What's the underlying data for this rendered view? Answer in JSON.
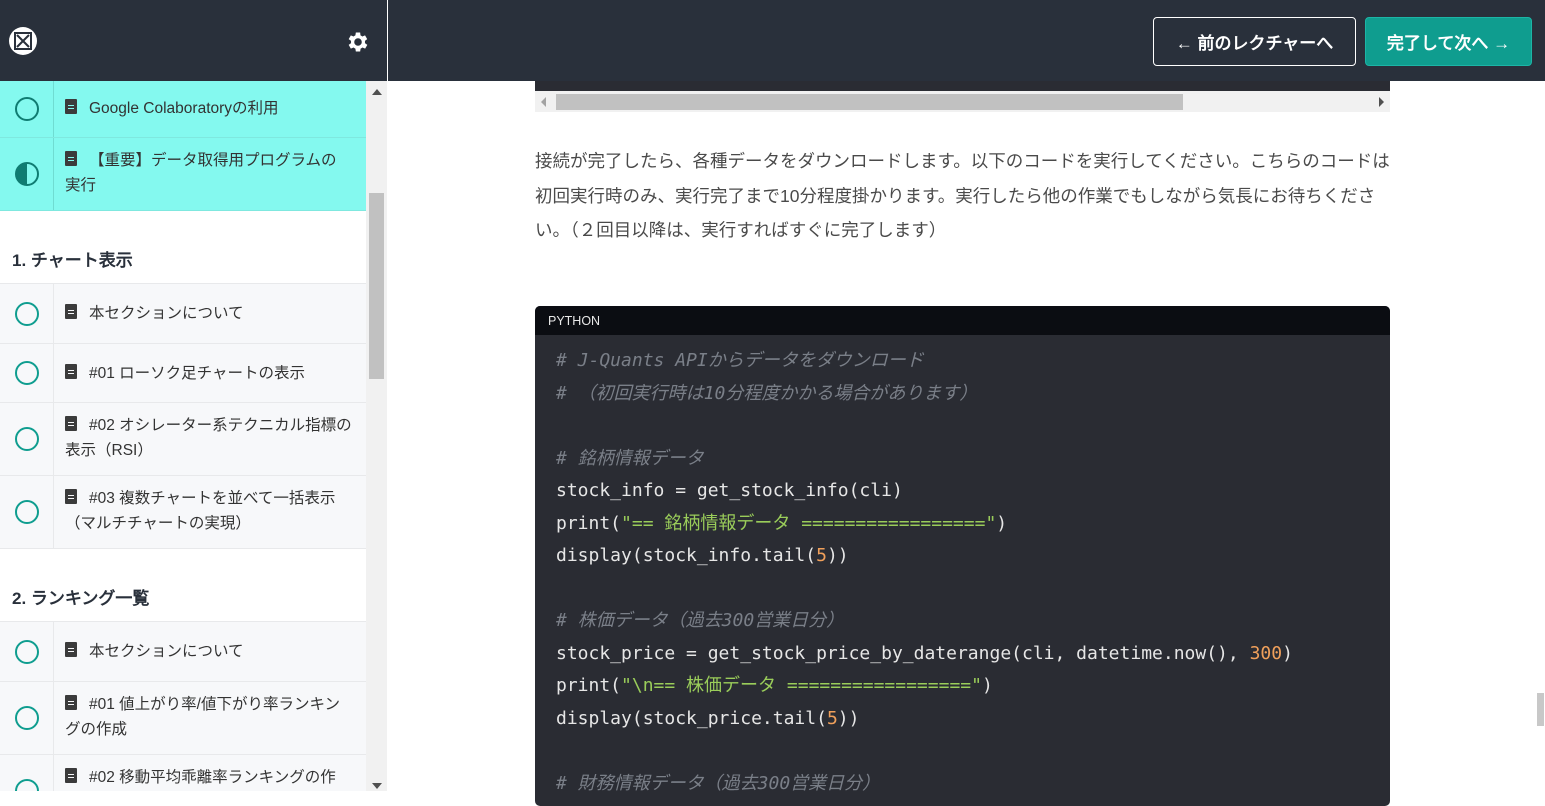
{
  "header": {
    "logo_icon": "udemy-logo-icon",
    "settings_icon": "gear-icon",
    "prev_button": "← 前のレクチャーへ",
    "next_button": "完了して次へ →"
  },
  "sidebar": {
    "items_top": [
      {
        "label": "Google Colaboratoryの利用",
        "status": "incomplete",
        "active": true
      },
      {
        "label": "【重要】データ取得用プログラムの実行",
        "status": "in-progress",
        "active": true
      }
    ],
    "sections": [
      {
        "title": "1. チャート表示",
        "items": [
          {
            "label": "本セクションについて",
            "status": "incomplete"
          },
          {
            "label": "#01 ローソク足チャートの表示",
            "status": "incomplete"
          },
          {
            "label": "#02 オシレーター系テクニカル指標の表示（RSI）",
            "status": "incomplete"
          },
          {
            "label": "#03 複数チャートを並べて一括表示（マルチチャートの実現）",
            "status": "incomplete"
          }
        ]
      },
      {
        "title": "2. ランキング一覧",
        "items": [
          {
            "label": "本セクションについて",
            "status": "incomplete"
          },
          {
            "label": "#01 値上がり率/値下がり率ランキングの作成",
            "status": "incomplete"
          },
          {
            "label": "#02 移動平均乖離率ランキングの作",
            "status": "incomplete"
          }
        ]
      }
    ]
  },
  "content": {
    "paragraph": "接続が完了したら、各種データをダウンロードします。以下のコードを実行してください。こちらのコードは初回実行時のみ、実行完了まで10分程度掛かります。実行したら他の作業でもしながら気長にお待ちください。（２回目以降は、実行すればすぐに完了します）",
    "code": {
      "language": "PYTHON",
      "lines": [
        "# J-Quants APIからデータをダウンロード",
        "# （初回実行時は10分程度かかる場合があります）",
        "",
        "# 銘柄情報データ",
        "stock_info = get_stock_info(cli)",
        "print(\"== 銘柄情報データ =================\")",
        "display(stock_info.tail(5))",
        "",
        "# 株価データ（過去300営業日分）",
        "stock_price = get_stock_price_by_daterange(cli, datetime.now(), 300)",
        "print(\"\\n== 株価データ =================\")",
        "display(stock_price.tail(5))",
        "",
        "# 財務情報データ（過去300営業日分）"
      ]
    }
  }
}
